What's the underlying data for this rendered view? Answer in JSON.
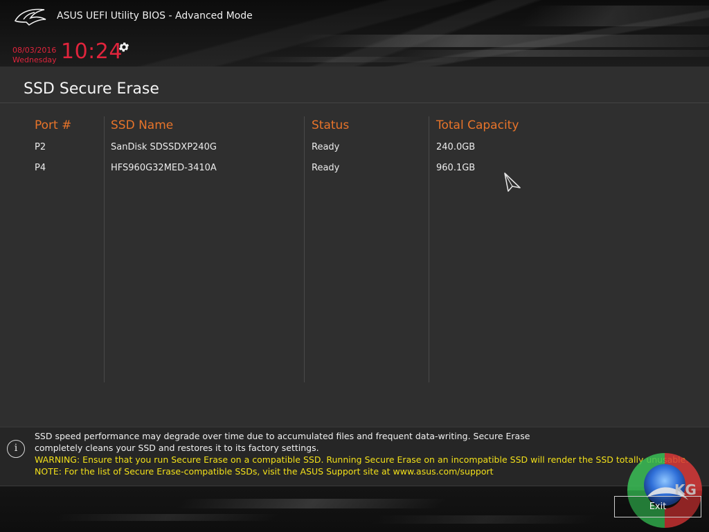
{
  "header": {
    "title": "ASUS UEFI Utility BIOS - Advanced Mode",
    "date": "08/03/2016",
    "weekday": "Wednesday",
    "time": "10:24",
    "logo_icon": "rog-logo-icon",
    "settings_icon": "gear-icon"
  },
  "page": {
    "title": "SSD Secure Erase"
  },
  "table": {
    "columns": [
      "Port #",
      "SSD Name",
      "Status",
      "Total Capacity"
    ],
    "rows": [
      [
        "P2",
        "SanDisk SDSSDXP240G",
        "Ready",
        "240.0GB"
      ],
      [
        "P4",
        "HFS960G32MED-3410A",
        "Ready",
        "960.1GB"
      ]
    ]
  },
  "info": {
    "icon": "info-icon",
    "lines": [
      "SSD speed performance may degrade over time due to accumulated files and frequent data-writing. Secure Erase",
      "completely cleans your SSD and restores it to its factory settings.",
      "WARNING: Ensure that you run Secure Erase on a compatible SSD. Running Secure Erase on an incompatible SSD will render the SSD totally unusable.",
      "NOTE: For the list of Secure Erase-compatible SSDs, visit the ASUS Support site at www.asus.com/support"
    ]
  },
  "footer": {
    "exit_label": "Exit",
    "watermark_text": "KG"
  },
  "colors": {
    "accent_red": "#e0243c",
    "column_header_orange": "#e8742a",
    "warning_yellow": "#f2e01a",
    "panel_bg": "#2f2f2f"
  }
}
